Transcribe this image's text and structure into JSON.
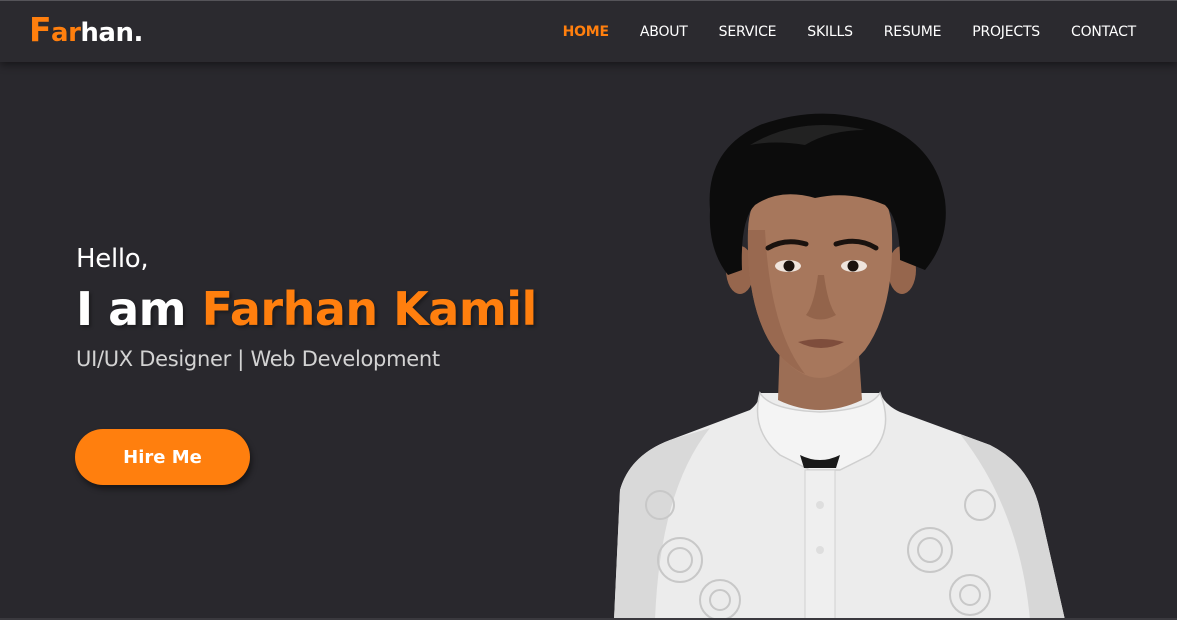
{
  "logo": {
    "first_letter": "F",
    "orange_part": "ar",
    "white_part": "han."
  },
  "nav": {
    "items": [
      {
        "label": "HOME",
        "active": true
      },
      {
        "label": "ABOUT"
      },
      {
        "label": "SERVICE"
      },
      {
        "label": "SKILLS"
      },
      {
        "label": "RESUME"
      },
      {
        "label": "PROJECTS"
      },
      {
        "label": "CONTACT"
      }
    ]
  },
  "hero": {
    "greeting": "Hello,",
    "intro": "I am ",
    "name": "Farhan Kamil",
    "role": "UI/UX Designer | Web Development",
    "cta_label": "Hire Me"
  },
  "colors": {
    "accent": "#ff7f0e",
    "background": "#29282d",
    "navbar": "#2b2a2f",
    "text": "#ffffff",
    "subtext": "#d3d3d3"
  }
}
